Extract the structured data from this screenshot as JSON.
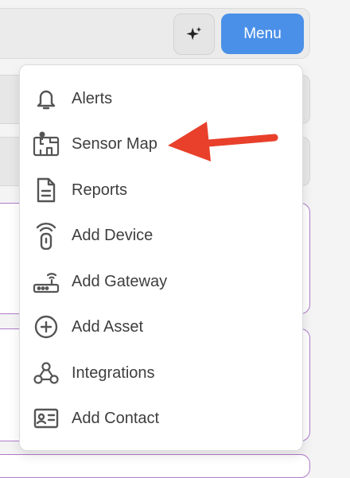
{
  "header": {
    "ai_icon": "sparkle-icon",
    "menu_label": "Menu"
  },
  "dropdown": {
    "items": [
      {
        "label": "Alerts",
        "icon": "bell-icon"
      },
      {
        "label": "Sensor Map",
        "icon": "sensor-map-icon"
      },
      {
        "label": "Reports",
        "icon": "document-icon"
      },
      {
        "label": "Add Device",
        "icon": "device-remote-icon"
      },
      {
        "label": "Add Gateway",
        "icon": "router-icon"
      },
      {
        "label": "Add Asset",
        "icon": "plus-circle-icon"
      },
      {
        "label": "Integrations",
        "icon": "webhook-icon"
      },
      {
        "label": "Add Contact",
        "icon": "contact-card-icon"
      }
    ]
  },
  "annotation": {
    "arrow_color": "#e8402a",
    "accent_color": "#4a90e8",
    "card_border_color": "#b07ac8"
  }
}
